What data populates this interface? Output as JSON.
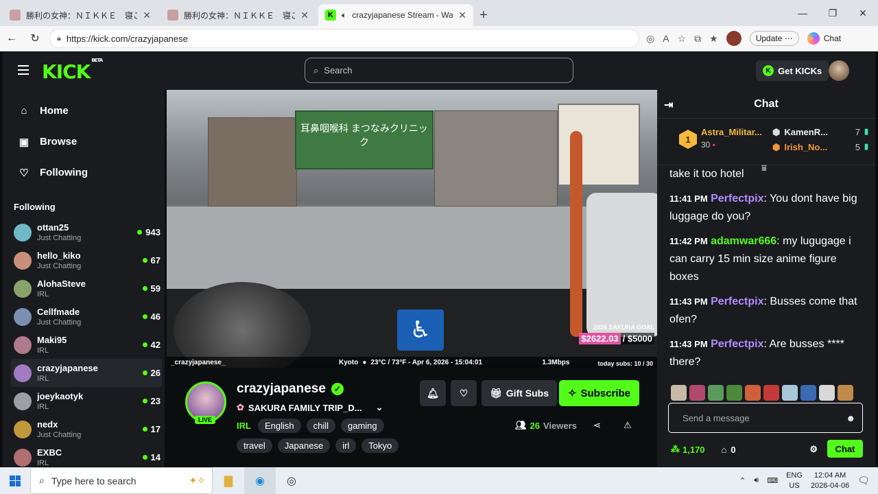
{
  "browser": {
    "tabs": [
      {
        "title": "勝利の女神：ＮＩＫＫＥ　寝ころび",
        "active": false
      },
      {
        "title": "勝利の女神：ＮＩＫＫＥ　寝ころび",
        "active": false
      },
      {
        "title": "crazyjapanese Stream - Watch",
        "active": true
      }
    ],
    "url": "https://kick.com/crazyjapanese",
    "update_label": "Update",
    "copilot_label": "Chat"
  },
  "kick": {
    "logo": "KICK",
    "logo_beta": "BETA",
    "search_placeholder": "Search",
    "get_kicks": "Get KICKs",
    "nav": [
      {
        "label": "Home",
        "icon": "home-icon"
      },
      {
        "label": "Browse",
        "icon": "browse-icon"
      },
      {
        "label": "Following",
        "icon": "heart-icon"
      }
    ],
    "following_header": "Following",
    "following": [
      {
        "name": "ottan25",
        "category": "Just Chatting",
        "viewers": "943",
        "color": "#6fb8c7"
      },
      {
        "name": "hello_kiko",
        "category": "Just Chatting",
        "viewers": "67",
        "color": "#c98f7a"
      },
      {
        "name": "AlohaSteve",
        "category": "IRL",
        "viewers": "59",
        "color": "#8aa36b"
      },
      {
        "name": "Cellfmade",
        "category": "Just Chatting",
        "viewers": "46",
        "color": "#7b8fb0"
      },
      {
        "name": "Maki95",
        "category": "IRL",
        "viewers": "42",
        "color": "#b07a8a"
      },
      {
        "name": "crazyjapanese",
        "category": "IRL",
        "viewers": "26",
        "color": "#a37bc0",
        "selected": true
      },
      {
        "name": "joeykaotyk",
        "category": "IRL",
        "viewers": "23",
        "color": "#9aa0a6"
      },
      {
        "name": "nedx",
        "category": "Just Chatting",
        "viewers": "17",
        "color": "#c09a3a"
      },
      {
        "name": "EXBC",
        "category": "IRL",
        "viewers": "14",
        "color": "#b07070"
      }
    ]
  },
  "video": {
    "sign_text": "耳鼻咽喉科 まつなみクリニック",
    "overlay_user": "_crazyjapanese_",
    "overlay_location": "Kyoto",
    "overlay_weather": "23°C / 73°F - Apr 6, 2026 - 15:04:01",
    "overlay_bitrate": "1.3Mbps",
    "goal_title": "2026 SAKURA GOAL",
    "goal_current": "$2622.03",
    "goal_target": "/ $5000",
    "today_subs": "today subs: 10 / 30"
  },
  "stream": {
    "channel": "crazyjapanese",
    "live_badge": "LIVE",
    "title": "SAKURA FAMILY TRIP_D...",
    "category": "IRL",
    "tags": [
      "English",
      "chill",
      "gaming",
      "travel",
      "Japanese",
      "irl",
      "Tokyo"
    ],
    "gift_subs": "Gift Subs",
    "subscribe": "Subscribe",
    "viewer_count": "26",
    "viewers_label": "Viewers"
  },
  "chat": {
    "title": "Chat",
    "top_gifter": {
      "rank": "1",
      "name": "Astra_Militar...",
      "count": "30"
    },
    "leaders": [
      {
        "name": "KamenR...",
        "count": "7"
      },
      {
        "name": "Irish_No...",
        "count": "5"
      }
    ],
    "messages": [
      {
        "time": "",
        "user": "",
        "user_color": "#ffffff",
        "text": "take it too hotel"
      },
      {
        "time": "11:41 PM",
        "user": "Perfectpix",
        "user_color": "#b58cff",
        "text": "You dont have big luggage do you?"
      },
      {
        "time": "11:42 PM",
        "user": "adamwar666",
        "user_color": "#53fc18",
        "text": "my lugugage i can carry 15 min size anime figure boxes"
      },
      {
        "time": "11:43 PM",
        "user": "Perfectpix",
        "user_color": "#b58cff",
        "text": "Busses come that ofen?"
      },
      {
        "time": "11:43 PM",
        "user": "Perfectpix",
        "user_color": "#b58cff",
        "text": "Are busses **** there?"
      }
    ],
    "input_placeholder": "Send a message",
    "points": "1,170",
    "gifts": "0",
    "send_label": "Chat"
  },
  "taskbar": {
    "search_placeholder": "Type here to search",
    "lang_top": "ENG",
    "lang_bottom": "US",
    "time": "12:04 AM",
    "date": "2026-04-06"
  }
}
